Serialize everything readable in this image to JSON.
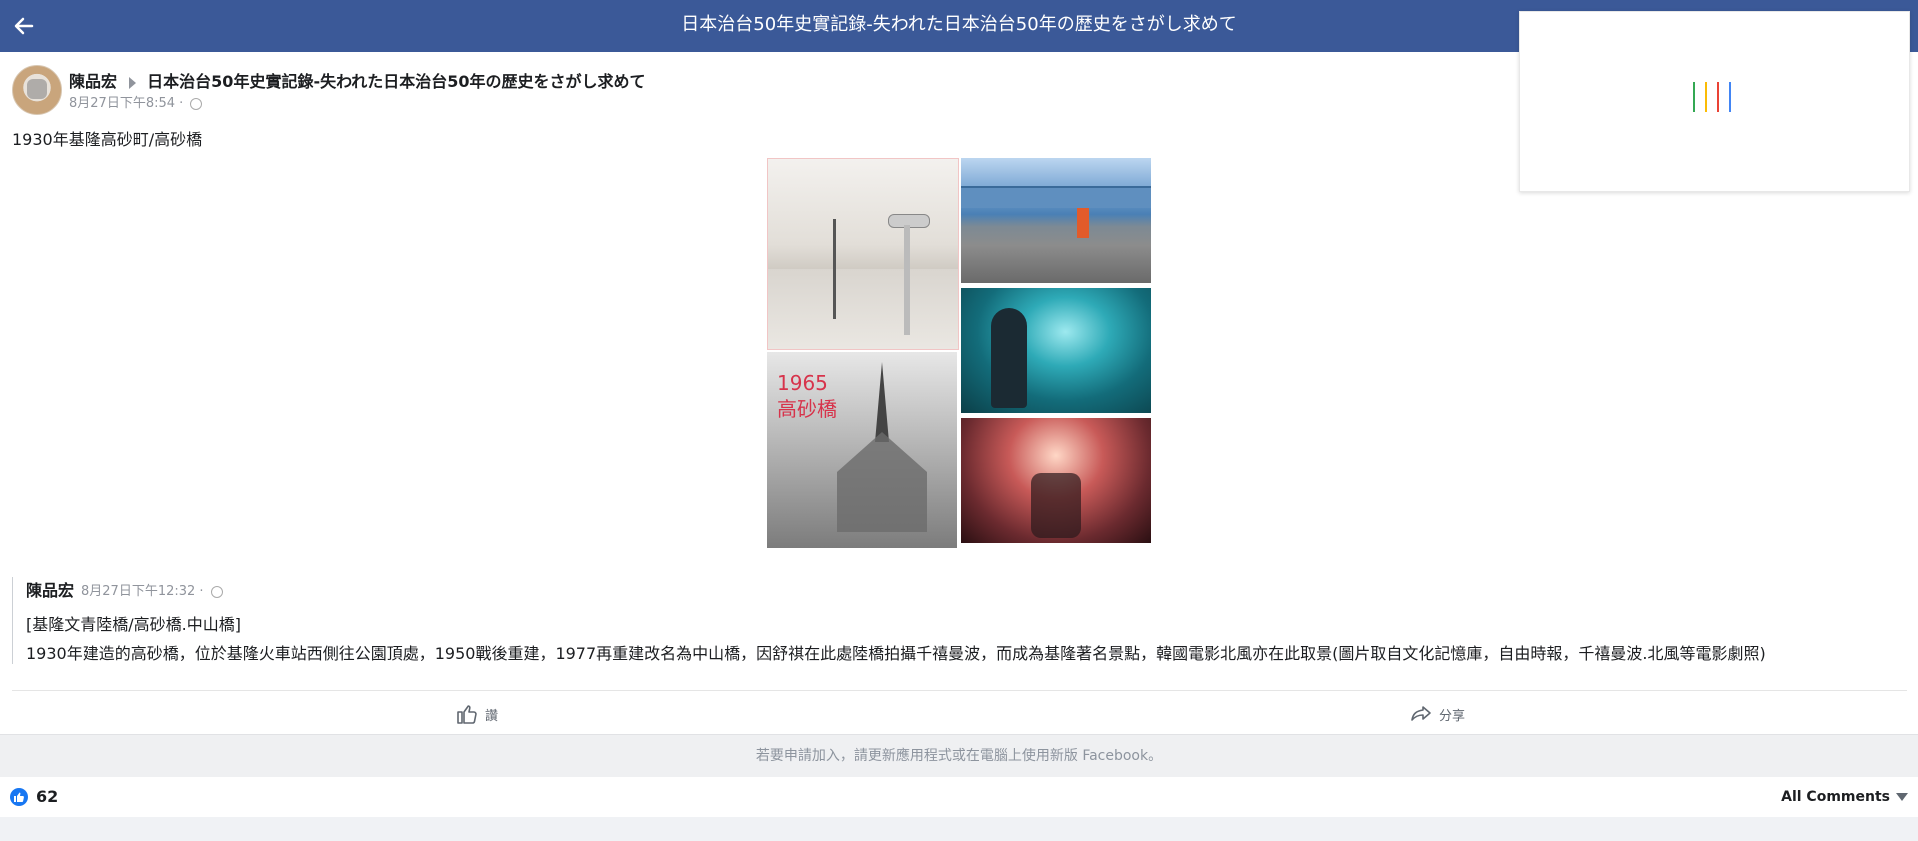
{
  "topbar": {
    "title": "日本治台50年史實記錄-失われた日本治台50年の歴史をさがし求めて"
  },
  "post": {
    "author": "陳品宏",
    "group": "日本治台50年史實記錄-失われた日本治台50年の歴史をさがし求めて",
    "time": "8月27日下午8:54 ·",
    "text": "1930年基隆高砂町/高砂橋",
    "photo_overlay_text_line1": "1965",
    "photo_overlay_text_line2": "高砂橋"
  },
  "quote": {
    "author": "陳品宏",
    "time": "8月27日下午12:32 ·",
    "title": "[基隆文青陸橋/高砂橋.中山橋]",
    "body": "1930年建造的高砂橋，位於基隆火車站西側往公園頂處，1950戰後重建，1977再重建改名為中山橋，因舒祺在此處陸橋拍攝千禧曼波，而成為基隆著名景點，韓國電影北風亦在此取景(圖片取自文化記憶庫，自由時報，千禧曼波.北風等電影劇照)"
  },
  "actions": {
    "like_label": "讚",
    "share_label": "分享"
  },
  "banner": {
    "text": "若要申請加入，請更新應用程式或在電腦上使用新版 Facebook。"
  },
  "footer": {
    "like_count": "62",
    "all_comments": "All Comments"
  },
  "colors": {
    "topbar": "#3b5998",
    "loader_bars": [
      "#34a853",
      "#fbbc05",
      "#ea4335",
      "#4285f4"
    ]
  }
}
